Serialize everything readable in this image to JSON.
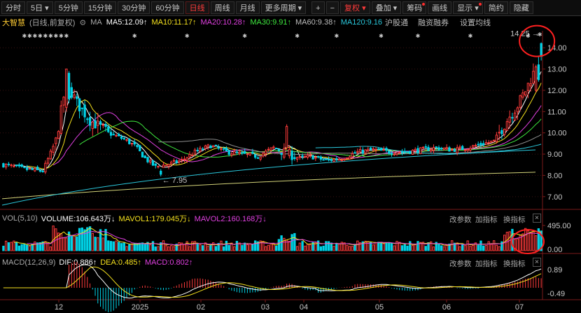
{
  "toolbar": {
    "periods": [
      "分时",
      "5日",
      "5分钟",
      "15分钟",
      "30分钟",
      "60分钟",
      "日线",
      "周线",
      "月线",
      "更多周期"
    ],
    "period_arrows": {
      "5日": "▾",
      "更多周期": "▾"
    },
    "active_period": "日线",
    "plus": "+",
    "minus": "−",
    "fuquan": "复权 ▾",
    "diejia": "叠加 ▾",
    "chouma": "筹码",
    "huaxian": "画线",
    "xianshi": "显示 ▾",
    "jianyue": "简约",
    "yincang": "隐藏"
  },
  "infobar": {
    "stock_name": "大智慧",
    "mode": "(日线,前复权)",
    "ma_label": "MA",
    "ma5": "MA5:12.09↑",
    "ma10": "MA10:11.17↑",
    "ma20": "MA20:10.28↑",
    "ma30": "MA30:9.91↑",
    "ma60": "MA60:9.38↑",
    "ma120": "MA120:9.16",
    "hgt": "沪股通",
    "rzrq": "融资融券",
    "settings": "设置均线"
  },
  "colors": {
    "up": "#ff3b3b",
    "down": "#00d2e6",
    "ma5": "#ffffff",
    "ma10": "#f5e11e",
    "ma20": "#e040e0",
    "ma30": "#3ee63e",
    "ma60": "#8c8c8c",
    "ma120": "#2ac8dc",
    "ma250": "#d2d278",
    "annot": "#ff2020"
  },
  "chart_data": [
    {
      "type": "candlestick",
      "price_axis": [
        "14.00",
        "13.00",
        "12.00",
        "11.00",
        "10.00",
        "9.00",
        "8.00",
        "7.00"
      ],
      "ylim": [
        6.5,
        14.6
      ],
      "high_marker": "14.25",
      "low_marker": "7.95",
      "x_labels": [
        "12",
        "2025",
        "02",
        "03",
        "04",
        "05",
        "06",
        "07"
      ],
      "trend": [
        [
          0,
          8.5
        ],
        [
          8,
          8.3
        ],
        [
          15,
          8.2
        ],
        [
          20,
          9.6
        ],
        [
          24,
          12.4
        ],
        [
          28,
          11.4
        ],
        [
          33,
          10.6
        ],
        [
          40,
          10.0
        ],
        [
          46,
          9.7
        ],
        [
          50,
          9.4
        ],
        [
          54,
          8.8
        ],
        [
          58,
          8.4
        ],
        [
          62,
          8.5
        ],
        [
          68,
          8.7
        ],
        [
          73,
          9.1
        ],
        [
          79,
          9.4
        ],
        [
          85,
          9.1
        ],
        [
          91,
          9.0
        ],
        [
          97,
          8.9
        ],
        [
          103,
          9.3
        ],
        [
          109,
          9.0
        ],
        [
          113,
          8.8
        ],
        [
          117,
          8.9
        ],
        [
          123,
          8.7
        ],
        [
          129,
          8.8
        ],
        [
          135,
          9.1
        ],
        [
          141,
          9.2
        ],
        [
          147,
          9.1
        ],
        [
          153,
          9.1
        ],
        [
          159,
          9.2
        ],
        [
          165,
          9.3
        ],
        [
          171,
          9.2
        ],
        [
          177,
          9.3
        ],
        [
          183,
          9.5
        ],
        [
          187,
          9.6
        ],
        [
          190,
          10.2
        ],
        [
          193,
          10.8
        ],
        [
          196,
          11.3
        ],
        [
          199,
          12.0
        ],
        [
          202,
          12.8
        ],
        [
          205,
          13.6
        ]
      ]
    },
    {
      "type": "bar",
      "title": "VOL(5,10)",
      "volume": "VOLUME:106.643万↓",
      "mavol1": "MAVOL1:179.045万↓",
      "mavol2": "MAVOL2:160.168万↓",
      "axis": [
        "495.00",
        "0.00"
      ],
      "buttons": [
        "改参数",
        "加指标",
        "换指标"
      ]
    },
    {
      "type": "bar",
      "title": "MACD(12,26,9)",
      "dif": "DIF:0.886↑",
      "dea": "DEA:0.485↑",
      "macd": "MACD:0.802↑",
      "axis": [
        "0.89",
        "-0.49"
      ],
      "buttons": [
        "改参数",
        "加指标",
        "换指标"
      ]
    }
  ]
}
